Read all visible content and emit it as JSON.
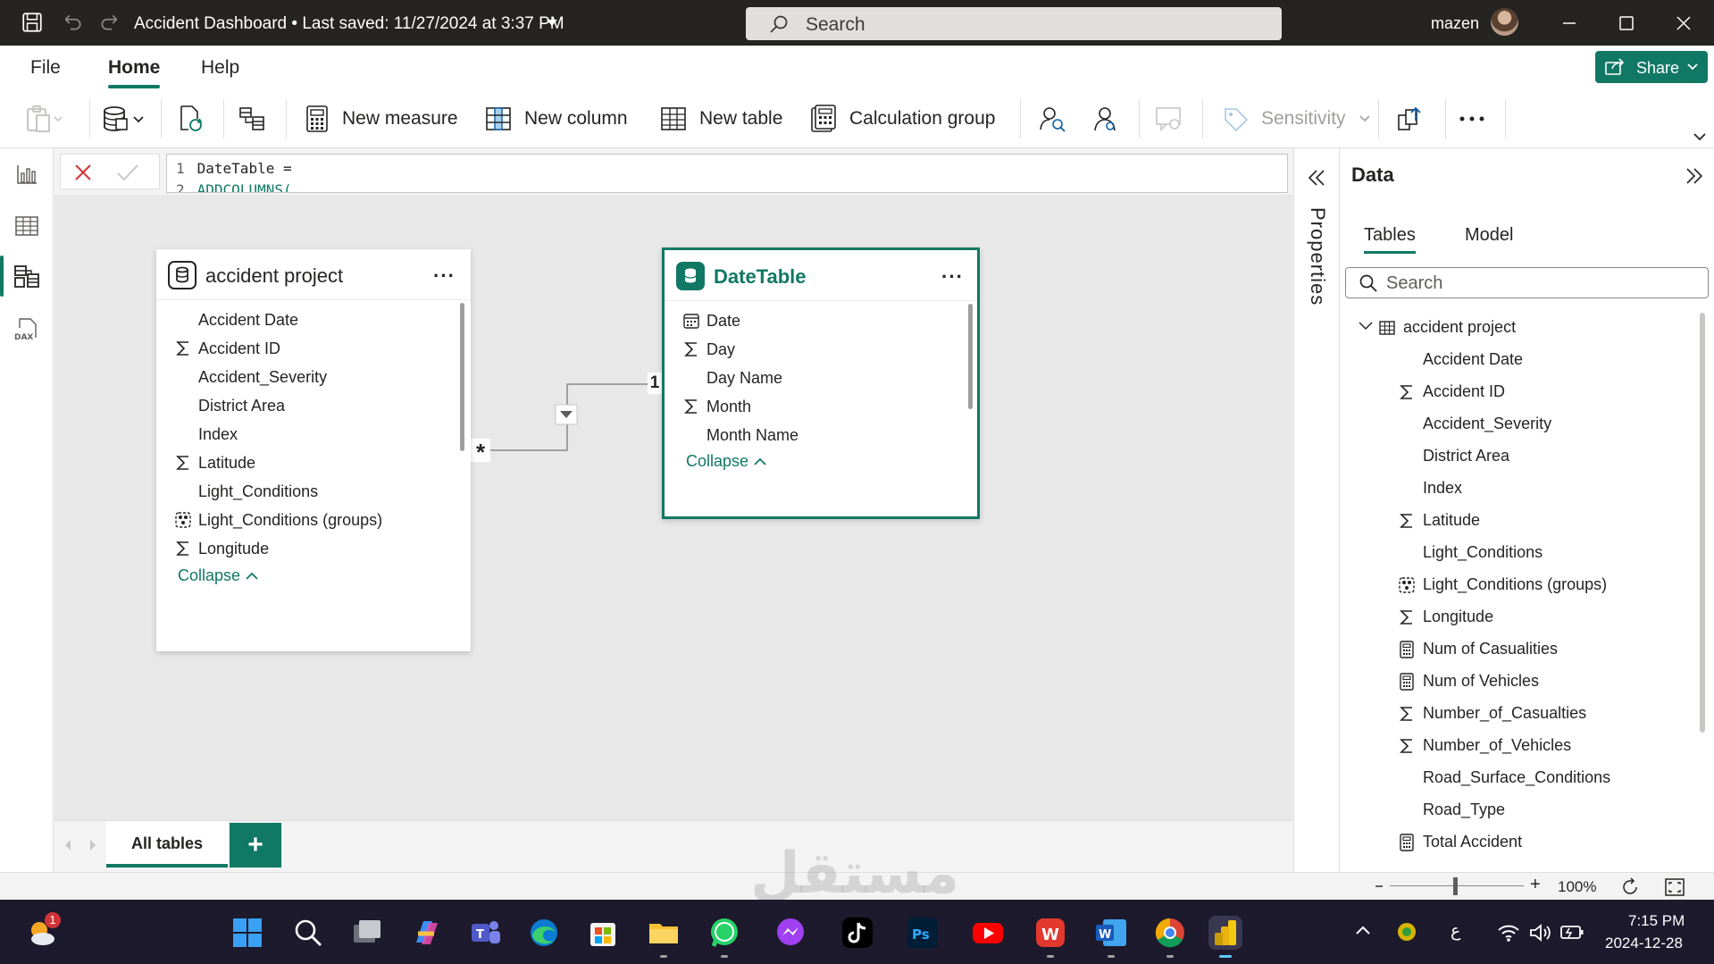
{
  "titlebar": {
    "document_title": "Accident Dashboard",
    "save_status": "Last saved: 11/27/2024 at 3:37 PM",
    "search_placeholder": "Search",
    "user_name": "mazen"
  },
  "menu": {
    "tabs": [
      {
        "label": "File",
        "active": false
      },
      {
        "label": "Home",
        "active": true
      },
      {
        "label": "Help",
        "active": false
      }
    ],
    "share_label": "Share"
  },
  "ribbon": {
    "new_measure": "New measure",
    "new_column": "New column",
    "new_table": "New table",
    "calculation_group": "Calculation group",
    "sensitivity": "Sensitivity"
  },
  "formula": {
    "lines": [
      {
        "num": "1",
        "code": "DateTable ="
      },
      {
        "num": "2",
        "code": "ADDCOLUMNS("
      }
    ]
  },
  "model": {
    "tables": [
      {
        "title": "accident project",
        "fields": [
          {
            "label": "Accident Date",
            "icon": "none"
          },
          {
            "label": "Accident ID",
            "icon": "sigma"
          },
          {
            "label": "Accident_Severity",
            "icon": "none"
          },
          {
            "label": "District Area",
            "icon": "none"
          },
          {
            "label": "Index",
            "icon": "none"
          },
          {
            "label": "Latitude",
            "icon": "sigma"
          },
          {
            "label": "Light_Conditions",
            "icon": "none"
          },
          {
            "label": "Light_Conditions (groups)",
            "icon": "group"
          },
          {
            "label": "Longitude",
            "icon": "sigma"
          }
        ],
        "collapse_label": "Collapse"
      },
      {
        "title": "DateTable",
        "fields": [
          {
            "label": "Date",
            "icon": "calendar"
          },
          {
            "label": "Day",
            "icon": "sigma"
          },
          {
            "label": "Day Name",
            "icon": "none"
          },
          {
            "label": "Month",
            "icon": "sigma"
          },
          {
            "label": "Month Name",
            "icon": "none"
          }
        ],
        "collapse_label": "Collapse"
      }
    ],
    "relationship": {
      "many_marker": "*",
      "one_marker": "1"
    }
  },
  "bottom_tabs": {
    "all_tables": "All tables",
    "add": "+"
  },
  "properties_label": "Properties",
  "data_pane": {
    "title": "Data",
    "tabs": [
      {
        "label": "Tables",
        "active": true
      },
      {
        "label": "Model",
        "active": false
      }
    ],
    "search_placeholder": "Search",
    "table_name": "accident project",
    "items": [
      {
        "label": "Accident Date",
        "icon": "none"
      },
      {
        "label": "Accident ID",
        "icon": "sigma"
      },
      {
        "label": "Accident_Severity",
        "icon": "none"
      },
      {
        "label": "District Area",
        "icon": "none"
      },
      {
        "label": "Index",
        "icon": "none"
      },
      {
        "label": "Latitude",
        "icon": "sigma"
      },
      {
        "label": "Light_Conditions",
        "icon": "none"
      },
      {
        "label": "Light_Conditions (groups)",
        "icon": "group"
      },
      {
        "label": "Longitude",
        "icon": "sigma"
      },
      {
        "label": "Num of Casualities",
        "icon": "calc"
      },
      {
        "label": "Num of Vehicles",
        "icon": "calc"
      },
      {
        "label": "Number_of_Casualties",
        "icon": "sigma"
      },
      {
        "label": "Number_of_Vehicles",
        "icon": "sigma"
      },
      {
        "label": "Road_Surface_Conditions",
        "icon": "none"
      },
      {
        "label": "Road_Type",
        "icon": "none"
      },
      {
        "label": "Total Accident",
        "icon": "calc"
      }
    ]
  },
  "statusbar": {
    "zoom": "100%"
  },
  "taskbar": {
    "weather_badge": "1",
    "time": "7:15 PM",
    "date": "2024-12-28",
    "input_lang": "ع"
  },
  "watermark": "مستقل",
  "colors": {
    "accent": "#117865",
    "titlebar": "#252423",
    "taskbar": "#1c1a2c"
  }
}
